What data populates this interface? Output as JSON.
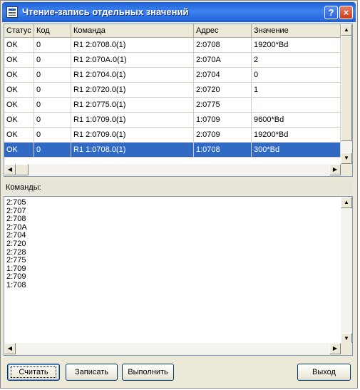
{
  "window": {
    "title": "Чтение-запись отдельных значений",
    "help_label": "?",
    "close_label": "×"
  },
  "table": {
    "columns": [
      "Статус",
      "Код",
      "Команда",
      "Адрес",
      "Значение"
    ],
    "rows": [
      [
        "OK",
        "0",
        "R1 2:0708.0(1)",
        "2:0708",
        "19200*Bd"
      ],
      [
        "OK",
        "0",
        "R1 2:070A.0(1)",
        "2:070A",
        "2"
      ],
      [
        "OK",
        "0",
        "R1 2:0704.0(1)",
        "2:0704",
        "0"
      ],
      [
        "OK",
        "0",
        "R1 2:0720.0(1)",
        "2:0720",
        "1"
      ],
      [
        "OK",
        "0",
        "R1 2:0775.0(1)",
        "2:0775",
        ""
      ],
      [
        "OK",
        "0",
        "R1 1:0709.0(1)",
        "1:0709",
        "9600*Bd"
      ],
      [
        "OK",
        "0",
        "R1 2:0709.0(1)",
        "2:0709",
        "19200*Bd"
      ],
      [
        "OK",
        "0",
        "R1 1:0708.0(1)",
        "1:0708",
        "300*Bd"
      ]
    ],
    "selected_row": 7
  },
  "commands": {
    "label": "Команды:",
    "lines": [
      "2:705",
      "2:707",
      "2:708",
      "2:70A",
      "2:704",
      "2:720",
      "2:728",
      "2:775",
      "1:709",
      "2:709",
      "1:708"
    ]
  },
  "buttons": {
    "read": "Считать",
    "write": "Записать",
    "execute": "Выполнить",
    "exit": "Выход"
  },
  "colors": {
    "title_bar": "#2b67dc",
    "selection": "#316ac5",
    "face": "#ece9d8"
  }
}
